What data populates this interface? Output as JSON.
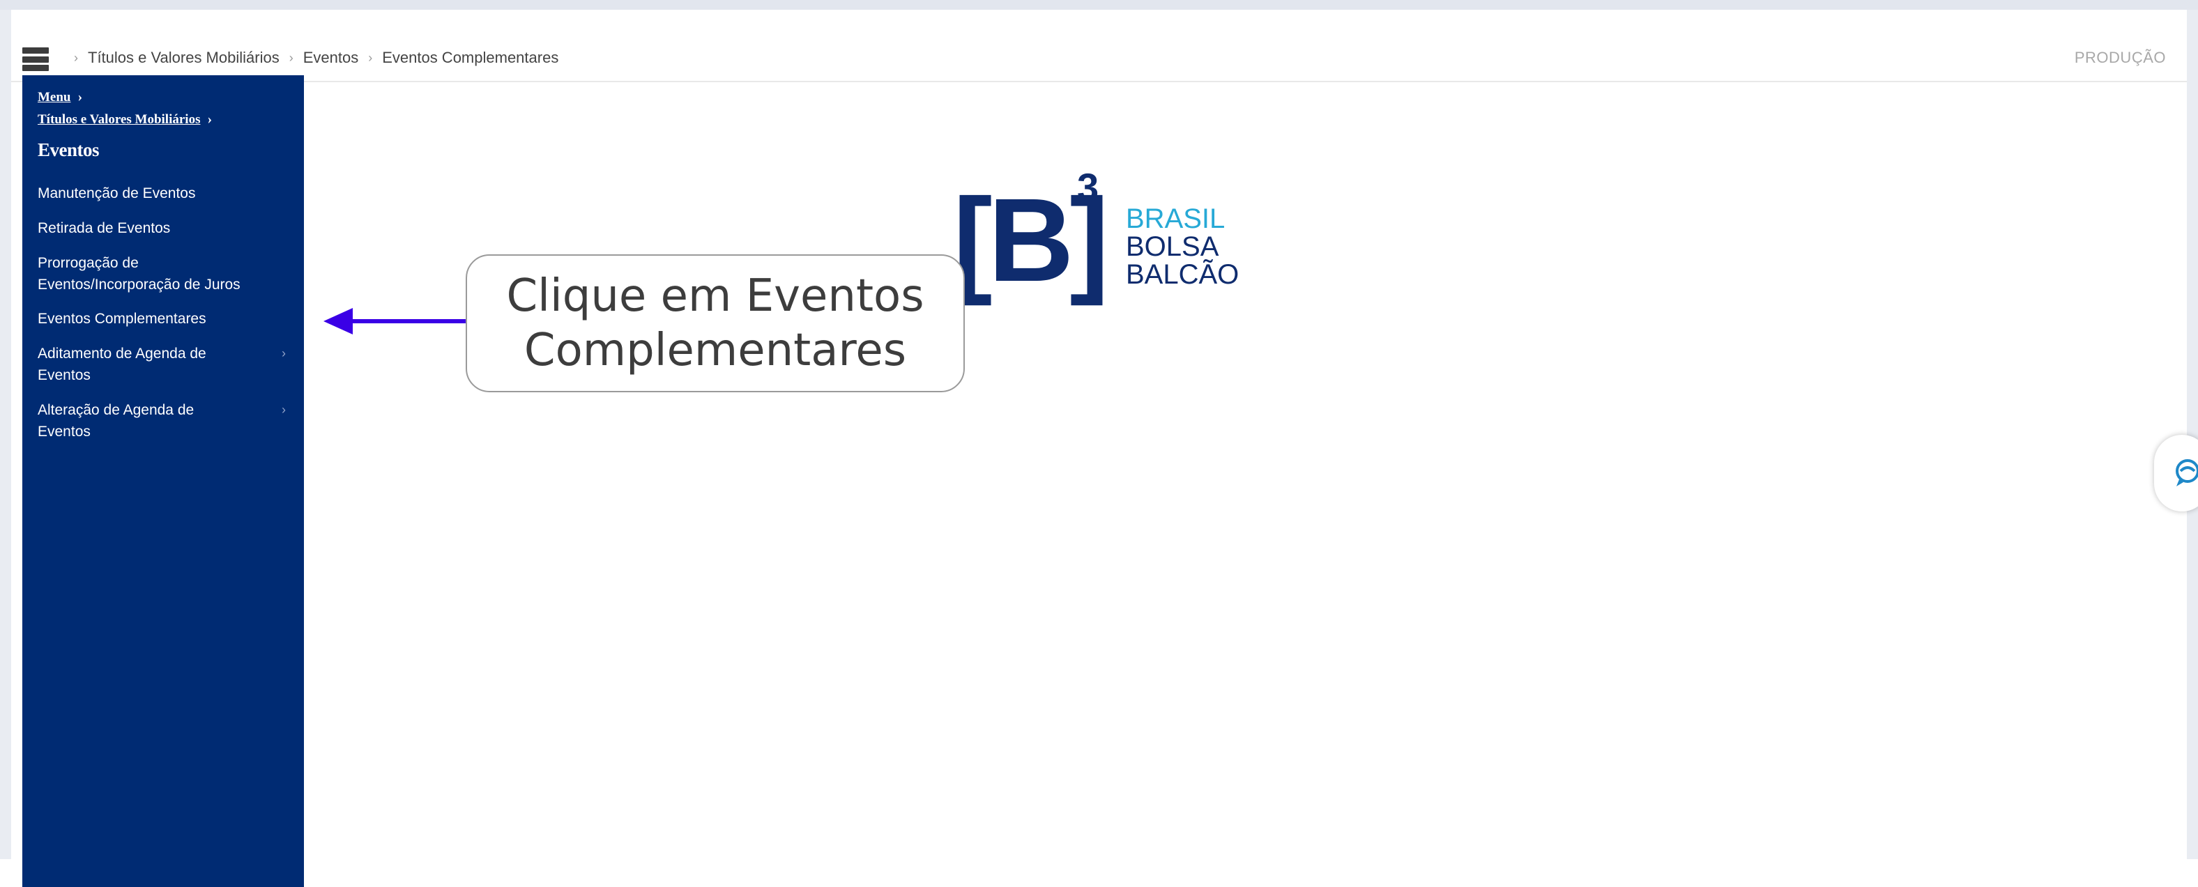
{
  "topbar": {
    "breadcrumb": [
      "Títulos e Valores Mobiliários",
      "Eventos",
      "Eventos Complementares"
    ],
    "environment": "PRODUÇÃO"
  },
  "sidebar": {
    "link_menu": "Menu",
    "link_parent": "Títulos e Valores Mobiliários",
    "title": "Eventos",
    "items": [
      {
        "label": "Manutenção de Eventos",
        "has_submenu": false
      },
      {
        "label": "Retirada de Eventos",
        "has_submenu": false
      },
      {
        "label": "Prorrogação de Eventos/Incorporação de Juros",
        "has_submenu": false
      },
      {
        "label": "Eventos Complementares",
        "has_submenu": false
      },
      {
        "label": "Aditamento de Agenda de Eventos",
        "has_submenu": true
      },
      {
        "label": "Alteração de Agenda de Eventos",
        "has_submenu": true
      }
    ]
  },
  "logo": {
    "mark": "[B]",
    "superscript": "3",
    "line1": "BRASIL",
    "line2": "BOLSA",
    "line3": "BALCÃO"
  },
  "callout": {
    "line1": "Clique em Eventos",
    "line2": "Complementares"
  },
  "colors": {
    "sidebar_bg": "#002b73",
    "logo_navy": "#0f2c6e",
    "logo_cyan": "#27a9d6",
    "callout_arrow": "#3a00e6"
  }
}
